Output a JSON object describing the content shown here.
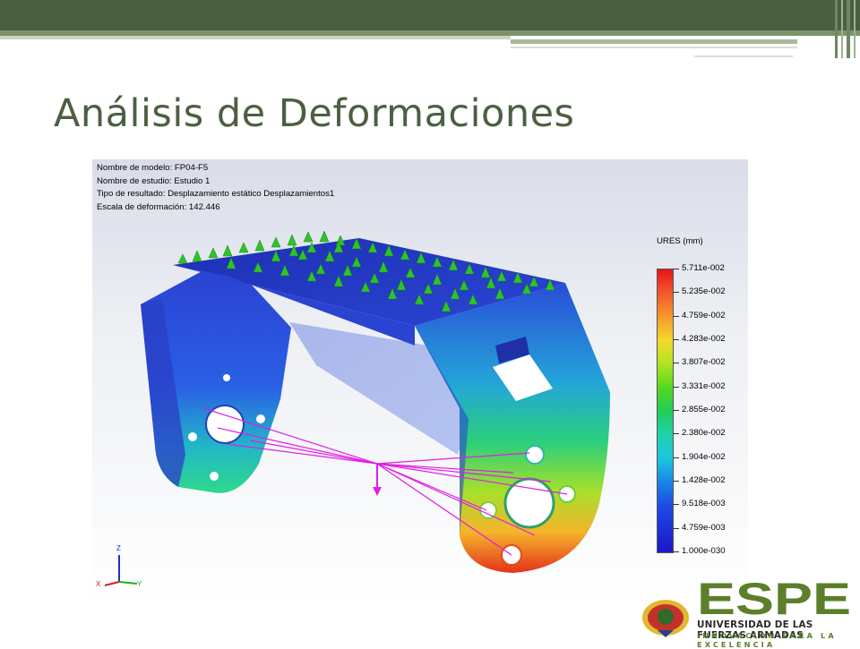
{
  "slide": {
    "title": "Análisis de Deformaciones"
  },
  "simulation": {
    "info_lines": [
      "Nombre de modelo: FP04-F5",
      "Nombre de estudio: Estudio 1",
      "Tipo de resultado: Desplazamiento estático Desplazamientos1",
      "Escala de deformación: 142.446"
    ],
    "legend": {
      "title": "URES (mm)",
      "values": [
        "5.711e-002",
        "5.235e-002",
        "4.759e-002",
        "4.283e-002",
        "3.807e-002",
        "3.331e-002",
        "2.855e-002",
        "2.380e-002",
        "1.904e-002",
        "1.428e-002",
        "9.518e-003",
        "4.759e-003",
        "1.000e-030"
      ]
    },
    "axis_triad": {
      "z": "Z",
      "x": "X",
      "y": "Y"
    }
  },
  "logo": {
    "wordmark": "ESPE",
    "name": "UNIVERSIDAD DE LAS FUERZAS ARMADAS",
    "motto": "INNOVACIÓN PARA LA EXCELENCIA"
  },
  "colors": {
    "header_green": "#4a5e42",
    "title_green": "#4b6042",
    "logo_green": "#5b7f2a"
  }
}
